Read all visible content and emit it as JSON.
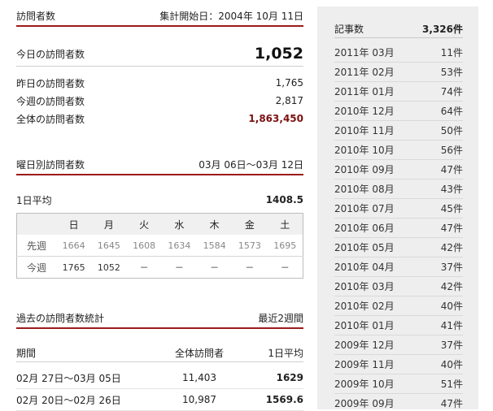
{
  "visitors": {
    "title": "訪問者数",
    "start_label": "集計開始日：2004年 10月 11日",
    "today_label": "今日の訪問者数",
    "today_value": "1,052",
    "yesterday_label": "昨日の訪問者数",
    "yesterday_value": "1,765",
    "week_label": "今週の訪問者数",
    "week_value": "2,817",
    "total_label": "全体の訪問者数",
    "total_value": "1,863,450"
  },
  "weekday": {
    "title": "曜日別訪問者数",
    "range": "03月 06日～03月 12日",
    "avg_label": "1日平均",
    "avg_value": "1408.5",
    "days": [
      "日",
      "月",
      "火",
      "水",
      "木",
      "金",
      "土"
    ],
    "rows": [
      {
        "label": "先週",
        "values": [
          "1664",
          "1645",
          "1608",
          "1634",
          "1584",
          "1573",
          "1695"
        ]
      },
      {
        "label": "今週",
        "values": [
          "1765",
          "1052",
          "－",
          "－",
          "－",
          "－",
          "－"
        ]
      }
    ]
  },
  "past": {
    "title": "過去の訪問者数統計",
    "period": "最近2週間",
    "col_period": "期間",
    "col_total": "全体訪問者",
    "col_avg": "1日平均",
    "rows": [
      {
        "period": "02月 27日～03月 05日",
        "total": "11,403",
        "avg": "1629"
      },
      {
        "period": "02月 20日～02月 26日",
        "total": "10,987",
        "avg": "1569.6"
      }
    ]
  },
  "articles": {
    "title": "記事数",
    "count": "3,326件",
    "months": [
      {
        "month": "2011年 03月",
        "count": "11件"
      },
      {
        "month": "2011年 02月",
        "count": "53件"
      },
      {
        "month": "2011年 01月",
        "count": "74件"
      },
      {
        "month": "2010年 12月",
        "count": "64件"
      },
      {
        "month": "2010年 11月",
        "count": "50件"
      },
      {
        "month": "2010年 10月",
        "count": "56件"
      },
      {
        "month": "2010年 09月",
        "count": "47件"
      },
      {
        "month": "2010年 08月",
        "count": "43件"
      },
      {
        "month": "2010年 07月",
        "count": "45件"
      },
      {
        "month": "2010年 06月",
        "count": "47件"
      },
      {
        "month": "2010年 05月",
        "count": "42件"
      },
      {
        "month": "2010年 04月",
        "count": "37件"
      },
      {
        "month": "2010年 03月",
        "count": "42件"
      },
      {
        "month": "2010年 02月",
        "count": "40件"
      },
      {
        "month": "2010年 01月",
        "count": "41件"
      },
      {
        "month": "2009年 12月",
        "count": "37件"
      },
      {
        "month": "2009年 11月",
        "count": "40件"
      },
      {
        "month": "2009年 10月",
        "count": "51件"
      },
      {
        "month": "2009年 09月",
        "count": "47件"
      }
    ]
  }
}
